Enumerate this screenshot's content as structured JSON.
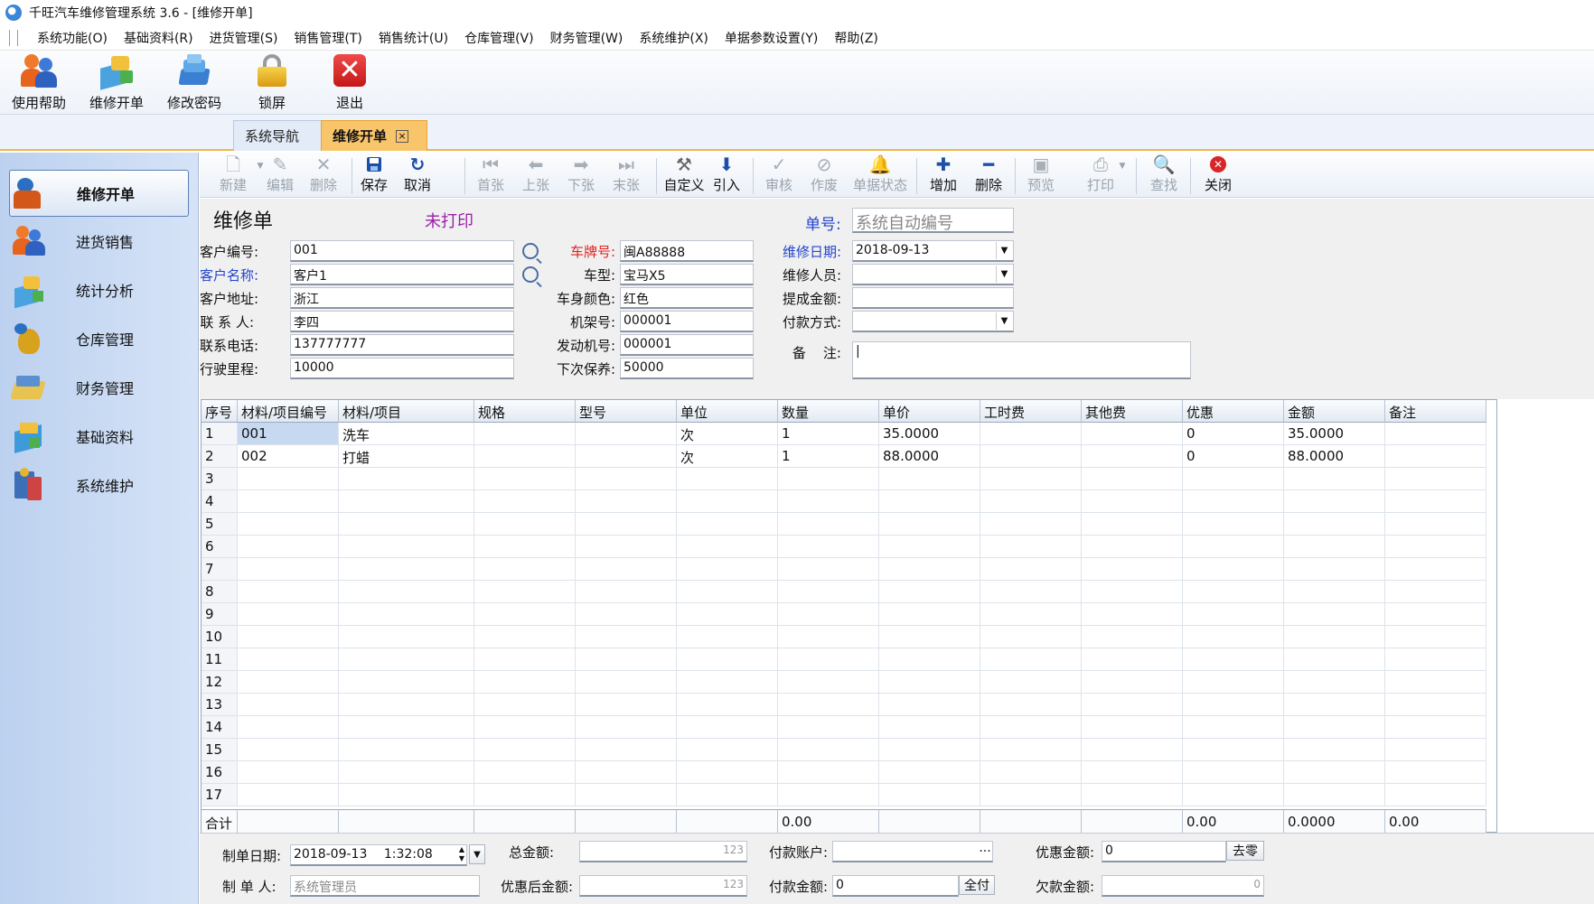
{
  "window": {
    "title": "千旺汽车维修管理系统 3.6 - [维修开单]"
  },
  "menu": [
    "系统功能(O)",
    "基础资料(R)",
    "进货管理(S)",
    "销售管理(T)",
    "销售统计(U)",
    "仓库管理(V)",
    "财务管理(W)",
    "系统维护(X)",
    "单据参数设置(Y)",
    "帮助(Z)"
  ],
  "quick_toolbar": [
    "使用帮助",
    "维修开单",
    "修改密码",
    "锁屏",
    "退出"
  ],
  "tabs": {
    "nav": "系统导航",
    "active": "维修开单",
    "close": "×"
  },
  "sidebar": [
    "维修开单",
    "进货销售",
    "统计分析",
    "仓库管理",
    "财务管理",
    "基础资料",
    "系统维护"
  ],
  "toolbar": {
    "new": "新建",
    "edit": "编辑",
    "delete": "删除",
    "save": "保存",
    "cancel": "取消",
    "first": "首张",
    "prev": "上张",
    "next": "下张",
    "last": "末张",
    "custom": "自定义",
    "import": "引入",
    "audit": "审核",
    "void": "作废",
    "status": "单据状态",
    "add": "增加",
    "remove": "删除",
    "preview": "预览",
    "print": "打印",
    "find": "查找",
    "close": "关闭"
  },
  "form": {
    "title": "维修单",
    "print_status": "未打印",
    "order_no_label": "单号:",
    "order_no_value": "系统自动编号",
    "customer_code_label": "客户编号:",
    "customer_code": "001",
    "customer_name_label": "客户名称:",
    "customer_name": "客户1",
    "customer_addr_label": "客户地址:",
    "customer_addr": "浙江",
    "contact_label": "联 系 人:",
    "contact": "李四",
    "phone_label": "联系电话:",
    "phone": "137777777",
    "mileage_label": "行驶里程:",
    "mileage": "10000",
    "plate_label": "车牌号:",
    "plate": "闽A88888",
    "model_label": "车型:",
    "model": "宝马X5",
    "color_label": "车身颜色:",
    "color": "红色",
    "vin_label": "机架号:",
    "vin": "000001",
    "engine_label": "发动机号:",
    "engine": "000001",
    "next_service_label": "下次保养:",
    "next_service": "50000",
    "repair_date_label": "维修日期:",
    "repair_date": "2018-09-13",
    "staff_label": "维修人员:",
    "staff": "",
    "commission_label": "提成金额:",
    "commission": "",
    "pay_method_label": "付款方式:",
    "pay_method": "",
    "remark_label": "备    注:",
    "remark": "|"
  },
  "grid": {
    "columns": [
      "序号",
      "材料/项目编号",
      "材料/项目",
      "规格",
      "型号",
      "单位",
      "数量",
      "单价",
      "工时费",
      "其他费",
      "优惠",
      "金额",
      "备注"
    ],
    "rows": [
      [
        "1",
        "001",
        "洗车",
        "",
        "",
        "次",
        "1",
        "35.0000",
        "",
        "",
        "0",
        "35.0000",
        ""
      ],
      [
        "2",
        "002",
        "打蜡",
        "",
        "",
        "次",
        "1",
        "88.0000",
        "",
        "",
        "0",
        "88.0000",
        ""
      ],
      [
        "3",
        "",
        "",
        "",
        "",
        "",
        "",
        "",
        "",
        "",
        "",
        "",
        ""
      ],
      [
        "4",
        "",
        "",
        "",
        "",
        "",
        "",
        "",
        "",
        "",
        "",
        "",
        ""
      ],
      [
        "5",
        "",
        "",
        "",
        "",
        "",
        "",
        "",
        "",
        "",
        "",
        "",
        ""
      ],
      [
        "6",
        "",
        "",
        "",
        "",
        "",
        "",
        "",
        "",
        "",
        "",
        "",
        ""
      ],
      [
        "7",
        "",
        "",
        "",
        "",
        "",
        "",
        "",
        "",
        "",
        "",
        "",
        ""
      ],
      [
        "8",
        "",
        "",
        "",
        "",
        "",
        "",
        "",
        "",
        "",
        "",
        "",
        ""
      ],
      [
        "9",
        "",
        "",
        "",
        "",
        "",
        "",
        "",
        "",
        "",
        "",
        "",
        ""
      ],
      [
        "10",
        "",
        "",
        "",
        "",
        "",
        "",
        "",
        "",
        "",
        "",
        "",
        ""
      ],
      [
        "11",
        "",
        "",
        "",
        "",
        "",
        "",
        "",
        "",
        "",
        "",
        "",
        ""
      ],
      [
        "12",
        "",
        "",
        "",
        "",
        "",
        "",
        "",
        "",
        "",
        "",
        "",
        ""
      ],
      [
        "13",
        "",
        "",
        "",
        "",
        "",
        "",
        "",
        "",
        "",
        "",
        "",
        ""
      ],
      [
        "14",
        "",
        "",
        "",
        "",
        "",
        "",
        "",
        "",
        "",
        "",
        "",
        ""
      ],
      [
        "15",
        "",
        "",
        "",
        "",
        "",
        "",
        "",
        "",
        "",
        "",
        "",
        ""
      ],
      [
        "16",
        "",
        "",
        "",
        "",
        "",
        "",
        "",
        "",
        "",
        "",
        "",
        ""
      ],
      [
        "17",
        "",
        "",
        "",
        "",
        "",
        "",
        "",
        "",
        "",
        "",
        "",
        ""
      ]
    ],
    "footer": [
      "合计",
      "",
      "",
      "",
      "",
      "",
      "0.00",
      "",
      "",
      "",
      "0.00",
      "0.0000",
      "0.00"
    ]
  },
  "bottom": {
    "created_date_label": "制单日期:",
    "created_date": "2018-09-13",
    "created_time": "1:32:08",
    "creator_label": "制 单 人:",
    "creator": "系统管理员",
    "total_label": "总金额:",
    "total": "123",
    "after_discount_label": "优惠后金额:",
    "after_discount": "123",
    "pay_account_label": "付款账户:",
    "pay_account": "",
    "pay_account_btn": "···",
    "pay_amount_label": "付款金额:",
    "pay_amount": "0",
    "pay_all_btn": "全付",
    "discount_label": "优惠金额:",
    "discount": "0",
    "round_btn": "去零",
    "owed_label": "欠款金额:",
    "owed": "0"
  },
  "colors": {
    "accent": "#f9c56a",
    "link_blue": "#2244cc",
    "required_red": "#e02020",
    "purple": "#9b1fa8",
    "sidebar_bg": "#c8daf2"
  }
}
